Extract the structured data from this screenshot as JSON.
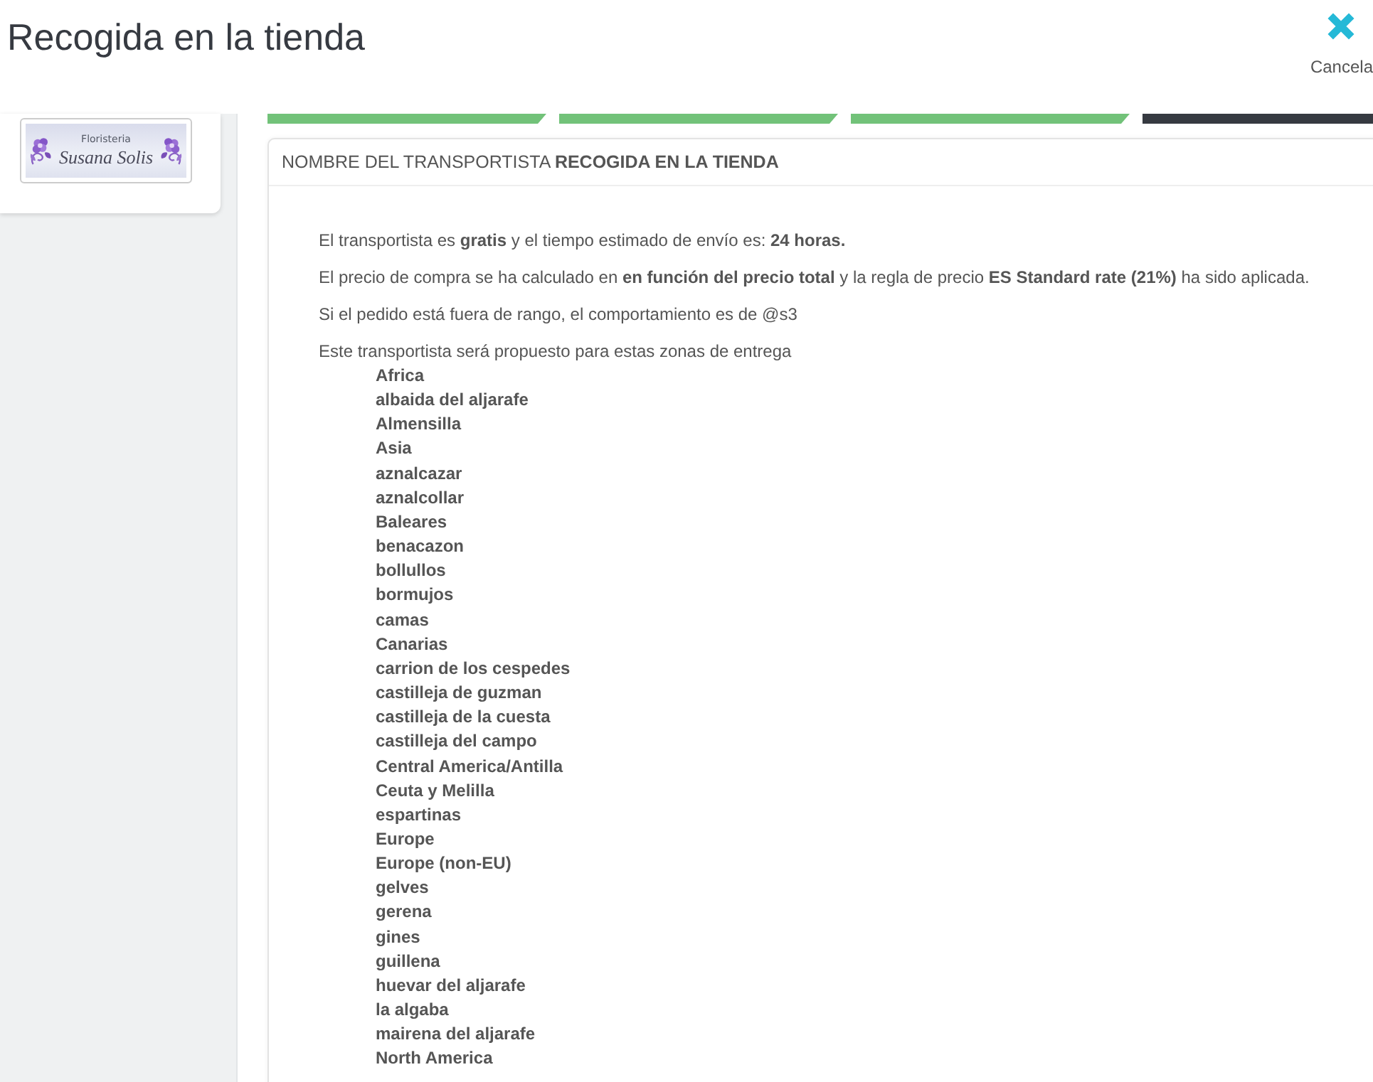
{
  "header": {
    "title": "Recogida en la tienda",
    "cancel_button": "Cancela"
  },
  "sidebar": {
    "logo": {
      "caption": "Floristeria",
      "name": "Susana Solis"
    }
  },
  "wizard_steps": [
    {
      "selected": false
    },
    {
      "selected": false
    },
    {
      "selected": false
    },
    {
      "selected": true
    }
  ],
  "panel": {
    "heading": "NOMBRE DEL TRANSPORTISTA **RECOGIDA EN LA TIENDA**",
    "paragraphs": [
      "El transportista es **gratis** y el tiempo estimado de envío es: **24 horas.**",
      "El precio de compra se ha calculado en **en función del precio total** y la regla de precio **ES Standard rate (21%)** ha sido aplicada.",
      "Si el pedido está fuera de rango, el comportamiento es de @s3",
      "Este transportista será propuesto para estas zonas de entrega"
    ],
    "zones": [
      "Africa",
      "albaida del aljarafe",
      "Almensilla",
      "Asia",
      "aznalcazar",
      "aznalcollar",
      "Baleares",
      "benacazon",
      "bollullos",
      "bormujos",
      "camas",
      "Canarias",
      "carrion de los cespedes",
      "castilleja de guzman",
      "castilleja de la cuesta",
      "castilleja del campo",
      "Central America/Antilla",
      "Ceuta y Melilla",
      "espartinas",
      "Europe",
      "Europe (non-EU)",
      "gelves",
      "gerena",
      "gines",
      "guillena",
      "huevar del aljarafe",
      "la algaba",
      "mairena del aljarafe",
      "North America"
    ]
  }
}
